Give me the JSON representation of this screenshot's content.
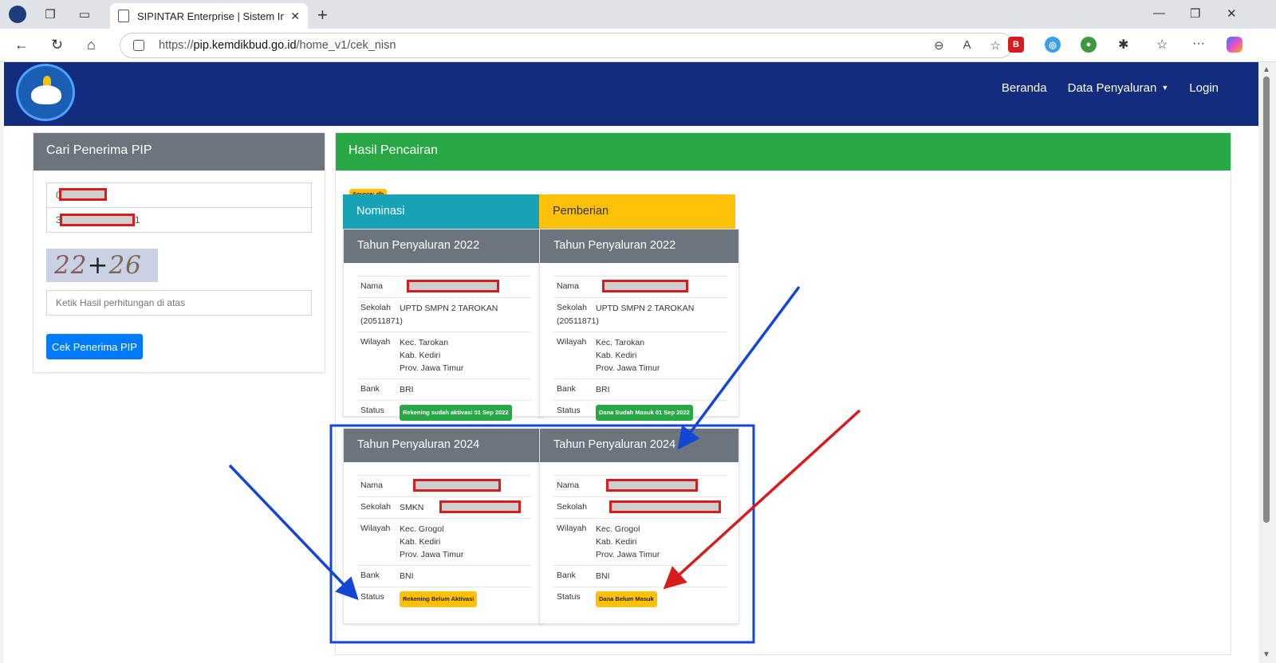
{
  "browser": {
    "tab_title": "SIPINTAR Enterprise | Sistem Infor",
    "url_prefix": "https://",
    "url_domain": "pip.kemdikbud.go.id",
    "url_path": "/home_v1/cek_nisn"
  },
  "navbar": {
    "items": [
      {
        "label": "Beranda"
      },
      {
        "label": "Data Penyaluran"
      },
      {
        "label": "Login"
      }
    ]
  },
  "search_panel": {
    "title": "Cari Penerima PIP",
    "field1_value_start": "0",
    "field2_value_start": "3",
    "field2_value_end": "1",
    "captcha_a": "22",
    "captcha_op": "+",
    "captcha_b": "26",
    "answer_placeholder": "Ketik Hasil perhitungan di atas",
    "submit_label": "Cek Penerima PIP"
  },
  "results": {
    "title": "Hasil Pencairan",
    "source_badge": "Source: db",
    "nominasi_label": "Nominasi",
    "pemberian_label": "Pemberian",
    "labels": {
      "nama": "Nama",
      "sekolah": "Sekolah",
      "wilayah": "Wilayah",
      "bank": "Bank",
      "status": "Status"
    },
    "cards": [
      {
        "year": "Tahun Penyaluran 2022",
        "sekolah": "UPTD SMPN 2 TAROKAN (20511871)",
        "wilayah": [
          "Kec. Tarokan",
          "Kab. Kediri",
          "Prov. Jawa Timur"
        ],
        "bank": "BRI",
        "status": "Rekening sudah aktivasi 01 Sep 2022",
        "status_color": "#28a745"
      },
      {
        "year": "Tahun Penyaluran 2022",
        "sekolah": "UPTD SMPN 2 TAROKAN (20511871)",
        "wilayah": [
          "Kec. Tarokan",
          "Kab. Kediri",
          "Prov. Jawa Timur"
        ],
        "bank": "BRI",
        "status": "Dana Sudah Masuk 01 Sep 2022",
        "status_color": "#28a745"
      },
      {
        "year": "Tahun Penyaluran 2024",
        "sekolah": "SMKN",
        "wilayah": [
          "Kec. Grogol",
          "Kab. Kediri",
          "Prov. Jawa Timur"
        ],
        "bank": "BNI",
        "status": "Rekening Belum Aktivasi",
        "status_color": "#ffc107"
      },
      {
        "year": "Tahun Penyaluran 2024",
        "sekolah": "",
        "wilayah": [
          "Kec. Grogol",
          "Kab. Kediri",
          "Prov. Jawa Timur"
        ],
        "bank": "BNI",
        "status": "Dana Belum Masuk",
        "status_color": "#ffc107"
      }
    ]
  },
  "colors": {
    "navbar": "#132c7d",
    "annotation_blue": "#1446d6",
    "annotation_red": "#d61c1c"
  }
}
